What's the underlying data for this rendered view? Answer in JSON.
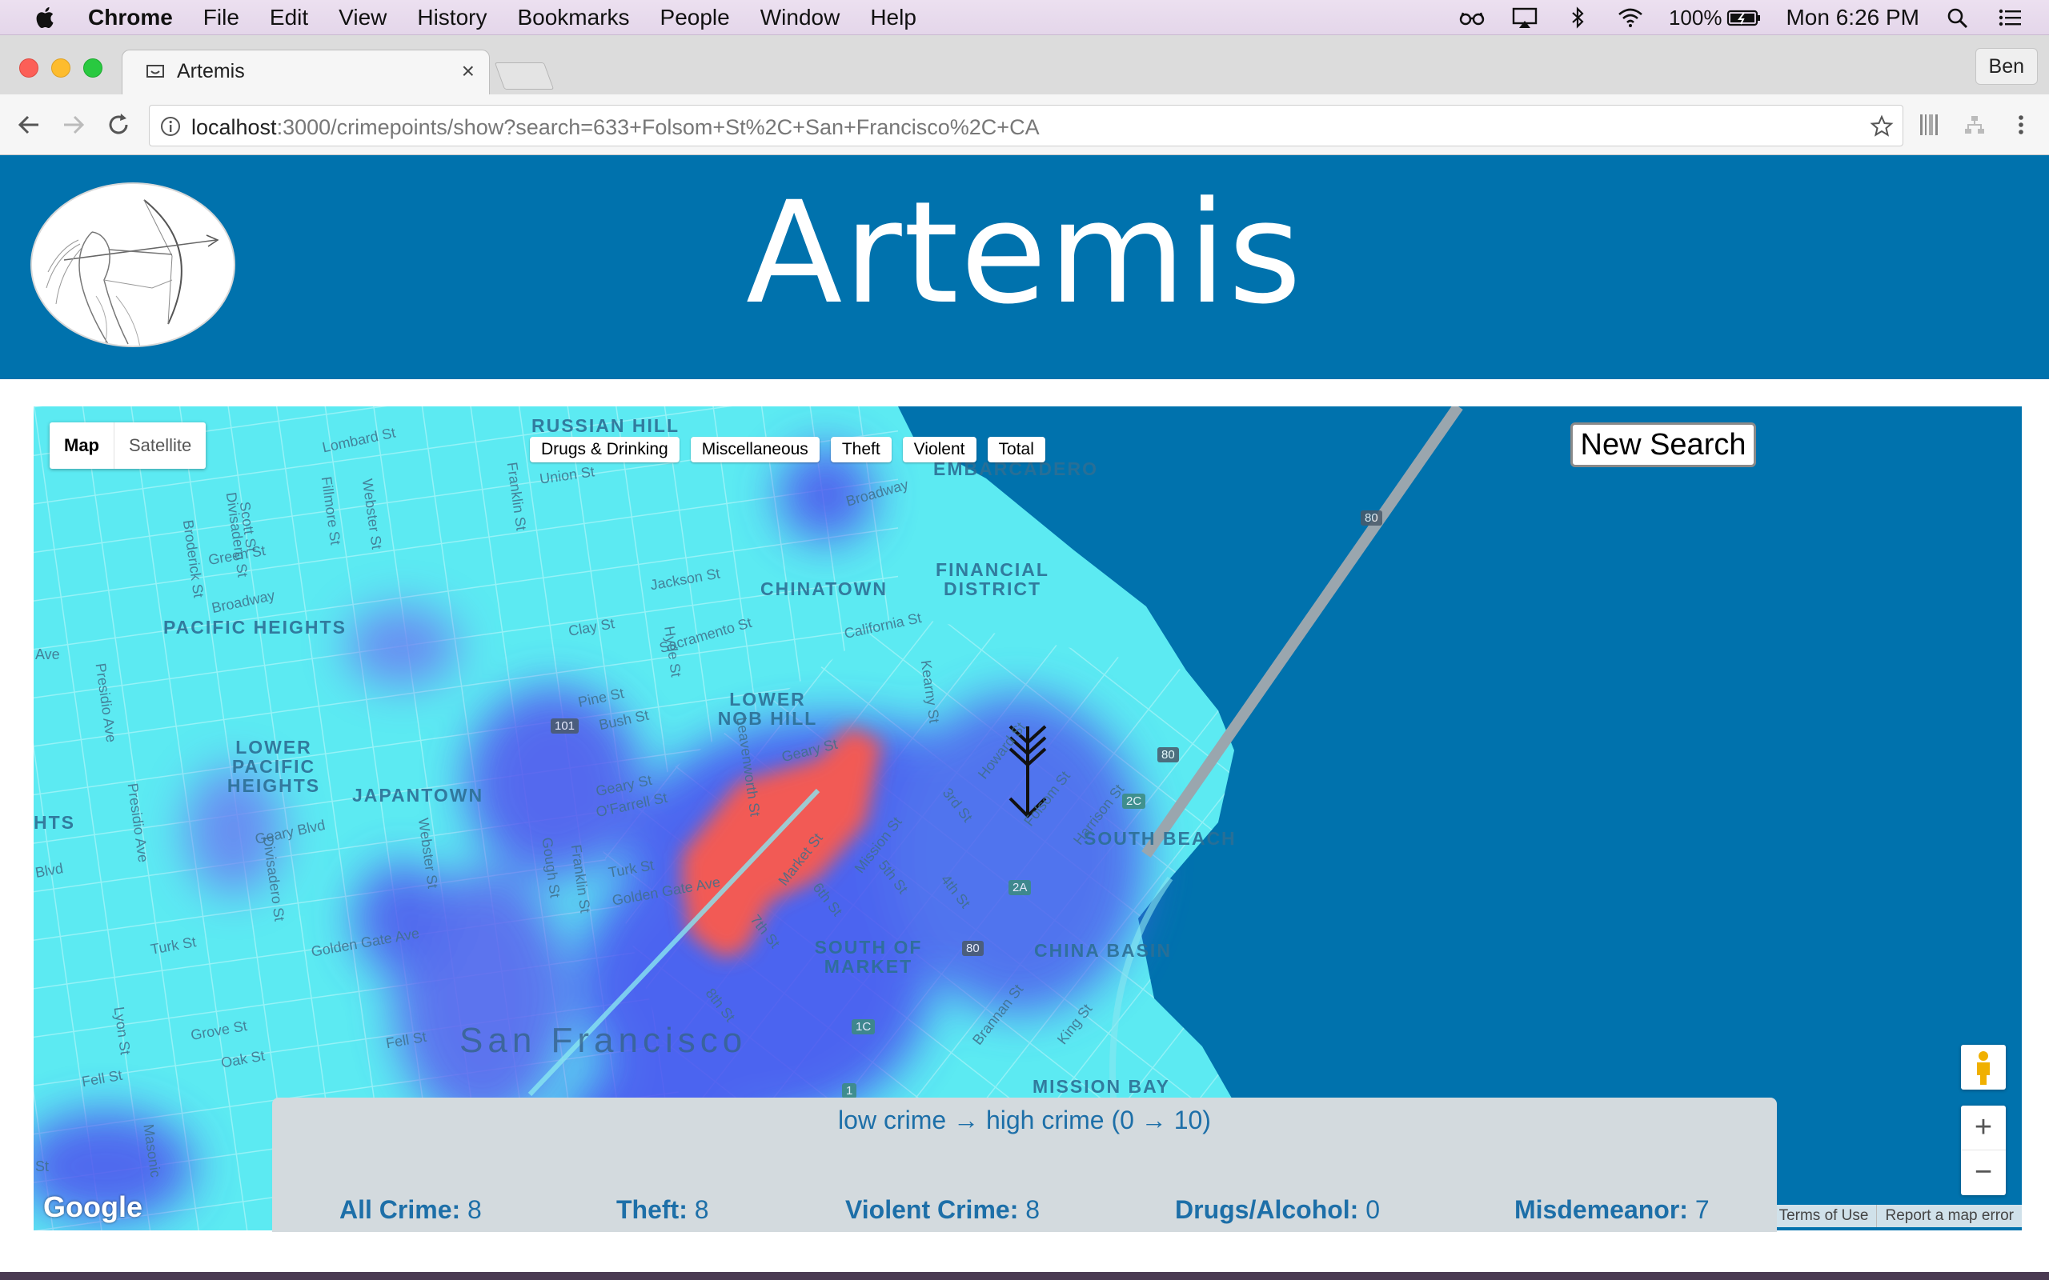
{
  "menubar": {
    "app_name": "Chrome",
    "items": [
      "File",
      "Edit",
      "View",
      "History",
      "Bookmarks",
      "People",
      "Window",
      "Help"
    ],
    "battery": "100%",
    "clock": "Mon 6:26 PM"
  },
  "browser": {
    "tab_title": "Artemis",
    "tab_close": "×",
    "profile_name": "Ben",
    "url_host": "localhost",
    "url_rest": ":3000/crimepoints/show?search=633+Folsom+St%2C+San+Francisco%2C+CA"
  },
  "site": {
    "title": "Artemis"
  },
  "map": {
    "type_map": "Map",
    "type_satellite": "Satellite",
    "layers": [
      "Drugs & Drinking",
      "Miscellaneous",
      "Theft",
      "Violent",
      "Total"
    ],
    "new_search": "New Search",
    "neighborhoods": {
      "russian_hill": "RUSSIAN HILL",
      "embarcadero": "EMBARCADERO",
      "financial_district": "FINANCIAL DISTRICT",
      "chinatown": "CHINATOWN",
      "pacific_heights": "PACIFIC HEIGHTS",
      "lower_nob_hill": "LOWER NOB HILL",
      "lower_pacific_heights": "LOWER PACIFIC HEIGHTS",
      "japantown": "JAPANTOWN",
      "south_beach": "SOUTH BEACH",
      "south_of_market": "SOUTH OF MARKET",
      "china_basin": "CHINA BASIN",
      "mission_bay": "MISSION BAY",
      "hts": "HTS"
    },
    "streets": {
      "lombard": "Lombard St",
      "union": "Union St",
      "broadway_e": "Broadway",
      "broadway_w": "Broadway",
      "green": "Green St",
      "jackson": "Jackson St",
      "clay": "Clay St",
      "sacramento": "Sacramento St",
      "california": "California St",
      "pine": "Pine St",
      "bush": "Bush St",
      "geary_e": "Geary St",
      "geary_w": "Geary St",
      "ofarrell": "O'Farrell St",
      "geary_blvd": "Geary Blvd",
      "turk": "Turk St",
      "golden_gate": "Golden Gate Ave",
      "golden_gate_w": "Golden Gate Ave",
      "turk_w": "Turk St",
      "grove": "Grove St",
      "fell": "Fell St",
      "fell_w": "Fell St",
      "oak": "Oak St",
      "market": "Market St",
      "mission": "Mission St",
      "howard": "Howard St",
      "folsom": "Folsom St",
      "harrison": "Harrison St",
      "brannan": "Brannan St",
      "king": "King St",
      "fillmore": "Fillmore St",
      "webster": "Webster St",
      "franklin": "Franklin St",
      "divisadero": "Divisadero St",
      "hyde": "Hyde St",
      "leavenworth": "Leavenworth St",
      "kearny": "Kearny St",
      "gough": "Gough St",
      "polk": "Polk St",
      "fifth": "5th St",
      "sixth": "6th St",
      "seventh": "7th St",
      "eighth": "8th St",
      "third": "3rd St",
      "fourth": "4th St",
      "presidio": "Presidio Ave",
      "ave": "Ave",
      "lyon": "Lyon St",
      "masonic": "Masonic",
      "st": "St",
      "blvd": "Blvd",
      "scott": "Scott St",
      "broderick": "Broderick St"
    },
    "city_label": "San Francisco",
    "highways": [
      "80",
      "101",
      "80",
      "2C",
      "2A",
      "80",
      "1C",
      "1"
    ],
    "zoom_in": "+",
    "zoom_out": "−",
    "google": "Google",
    "terms": "Terms of Use",
    "report_error": "Report a map error"
  },
  "legend": {
    "scale": "low crime → high crime (0 → 10)",
    "stats": [
      {
        "label": "All Crime:",
        "value": "8"
      },
      {
        "label": "Theft:",
        "value": "8"
      },
      {
        "label": "Violent Crime:",
        "value": "8"
      },
      {
        "label": "Drugs/Alcohol:",
        "value": "0"
      },
      {
        "label": "Misdemeanor:",
        "value": "7"
      }
    ]
  },
  "colors": {
    "header_bg": "#0072ad",
    "water": "#0072ad",
    "heat_low": "#5cf0f0",
    "heat_mid": "#4a5af0",
    "heat_high": "#f25a54",
    "legend_text": "#1d6fa8"
  }
}
